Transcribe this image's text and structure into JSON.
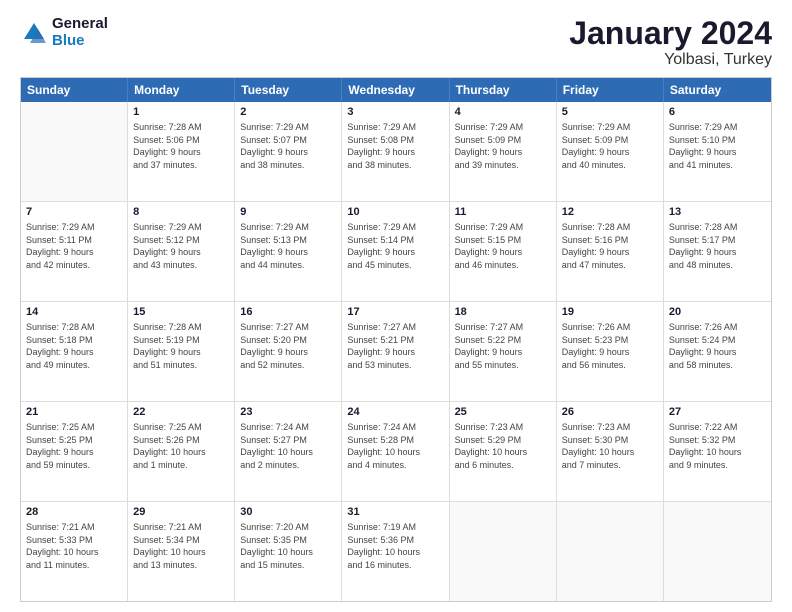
{
  "logo": {
    "line1": "General",
    "line2": "Blue"
  },
  "title": "January 2024",
  "subtitle": "Yolbasi, Turkey",
  "header_days": [
    "Sunday",
    "Monday",
    "Tuesday",
    "Wednesday",
    "Thursday",
    "Friday",
    "Saturday"
  ],
  "weeks": [
    [
      {
        "date": "",
        "info": ""
      },
      {
        "date": "1",
        "info": "Sunrise: 7:28 AM\nSunset: 5:06 PM\nDaylight: 9 hours\nand 37 minutes."
      },
      {
        "date": "2",
        "info": "Sunrise: 7:29 AM\nSunset: 5:07 PM\nDaylight: 9 hours\nand 38 minutes."
      },
      {
        "date": "3",
        "info": "Sunrise: 7:29 AM\nSunset: 5:08 PM\nDaylight: 9 hours\nand 38 minutes."
      },
      {
        "date": "4",
        "info": "Sunrise: 7:29 AM\nSunset: 5:09 PM\nDaylight: 9 hours\nand 39 minutes."
      },
      {
        "date": "5",
        "info": "Sunrise: 7:29 AM\nSunset: 5:09 PM\nDaylight: 9 hours\nand 40 minutes."
      },
      {
        "date": "6",
        "info": "Sunrise: 7:29 AM\nSunset: 5:10 PM\nDaylight: 9 hours\nand 41 minutes."
      }
    ],
    [
      {
        "date": "7",
        "info": "Sunrise: 7:29 AM\nSunset: 5:11 PM\nDaylight: 9 hours\nand 42 minutes."
      },
      {
        "date": "8",
        "info": "Sunrise: 7:29 AM\nSunset: 5:12 PM\nDaylight: 9 hours\nand 43 minutes."
      },
      {
        "date": "9",
        "info": "Sunrise: 7:29 AM\nSunset: 5:13 PM\nDaylight: 9 hours\nand 44 minutes."
      },
      {
        "date": "10",
        "info": "Sunrise: 7:29 AM\nSunset: 5:14 PM\nDaylight: 9 hours\nand 45 minutes."
      },
      {
        "date": "11",
        "info": "Sunrise: 7:29 AM\nSunset: 5:15 PM\nDaylight: 9 hours\nand 46 minutes."
      },
      {
        "date": "12",
        "info": "Sunrise: 7:28 AM\nSunset: 5:16 PM\nDaylight: 9 hours\nand 47 minutes."
      },
      {
        "date": "13",
        "info": "Sunrise: 7:28 AM\nSunset: 5:17 PM\nDaylight: 9 hours\nand 48 minutes."
      }
    ],
    [
      {
        "date": "14",
        "info": "Sunrise: 7:28 AM\nSunset: 5:18 PM\nDaylight: 9 hours\nand 49 minutes."
      },
      {
        "date": "15",
        "info": "Sunrise: 7:28 AM\nSunset: 5:19 PM\nDaylight: 9 hours\nand 51 minutes."
      },
      {
        "date": "16",
        "info": "Sunrise: 7:27 AM\nSunset: 5:20 PM\nDaylight: 9 hours\nand 52 minutes."
      },
      {
        "date": "17",
        "info": "Sunrise: 7:27 AM\nSunset: 5:21 PM\nDaylight: 9 hours\nand 53 minutes."
      },
      {
        "date": "18",
        "info": "Sunrise: 7:27 AM\nSunset: 5:22 PM\nDaylight: 9 hours\nand 55 minutes."
      },
      {
        "date": "19",
        "info": "Sunrise: 7:26 AM\nSunset: 5:23 PM\nDaylight: 9 hours\nand 56 minutes."
      },
      {
        "date": "20",
        "info": "Sunrise: 7:26 AM\nSunset: 5:24 PM\nDaylight: 9 hours\nand 58 minutes."
      }
    ],
    [
      {
        "date": "21",
        "info": "Sunrise: 7:25 AM\nSunset: 5:25 PM\nDaylight: 9 hours\nand 59 minutes."
      },
      {
        "date": "22",
        "info": "Sunrise: 7:25 AM\nSunset: 5:26 PM\nDaylight: 10 hours\nand 1 minute."
      },
      {
        "date": "23",
        "info": "Sunrise: 7:24 AM\nSunset: 5:27 PM\nDaylight: 10 hours\nand 2 minutes."
      },
      {
        "date": "24",
        "info": "Sunrise: 7:24 AM\nSunset: 5:28 PM\nDaylight: 10 hours\nand 4 minutes."
      },
      {
        "date": "25",
        "info": "Sunrise: 7:23 AM\nSunset: 5:29 PM\nDaylight: 10 hours\nand 6 minutes."
      },
      {
        "date": "26",
        "info": "Sunrise: 7:23 AM\nSunset: 5:30 PM\nDaylight: 10 hours\nand 7 minutes."
      },
      {
        "date": "27",
        "info": "Sunrise: 7:22 AM\nSunset: 5:32 PM\nDaylight: 10 hours\nand 9 minutes."
      }
    ],
    [
      {
        "date": "28",
        "info": "Sunrise: 7:21 AM\nSunset: 5:33 PM\nDaylight: 10 hours\nand 11 minutes."
      },
      {
        "date": "29",
        "info": "Sunrise: 7:21 AM\nSunset: 5:34 PM\nDaylight: 10 hours\nand 13 minutes."
      },
      {
        "date": "30",
        "info": "Sunrise: 7:20 AM\nSunset: 5:35 PM\nDaylight: 10 hours\nand 15 minutes."
      },
      {
        "date": "31",
        "info": "Sunrise: 7:19 AM\nSunset: 5:36 PM\nDaylight: 10 hours\nand 16 minutes."
      },
      {
        "date": "",
        "info": ""
      },
      {
        "date": "",
        "info": ""
      },
      {
        "date": "",
        "info": ""
      }
    ]
  ]
}
